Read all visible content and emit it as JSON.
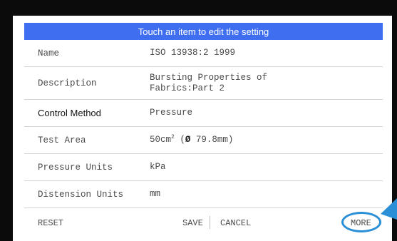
{
  "header": {
    "title": "Touch an item to edit the setting"
  },
  "settings": [
    {
      "label": "Name",
      "value": "ISO 13938:2 1999"
    },
    {
      "label": "Description",
      "value_line1": "Bursting Properties of",
      "value_line2": "Fabrics:Part 2"
    },
    {
      "label": "Control Method",
      "value": "Pressure"
    },
    {
      "label": "Test Area",
      "value_main": "50cm",
      "value_sup": "2",
      "value_diam_symbol": "Ø",
      "value_diam": "79.8mm"
    },
    {
      "label": "Pressure Units",
      "value": "kPa"
    },
    {
      "label": "Distension Units",
      "value": "mm"
    }
  ],
  "footer": {
    "reset_label": "RESET",
    "save_label": "SAVE",
    "cancel_label": "CANCEL",
    "more_label": "MORE"
  },
  "colors": {
    "header_bg": "#3f6ef0",
    "highlight_circle": "#2a8fd6"
  }
}
